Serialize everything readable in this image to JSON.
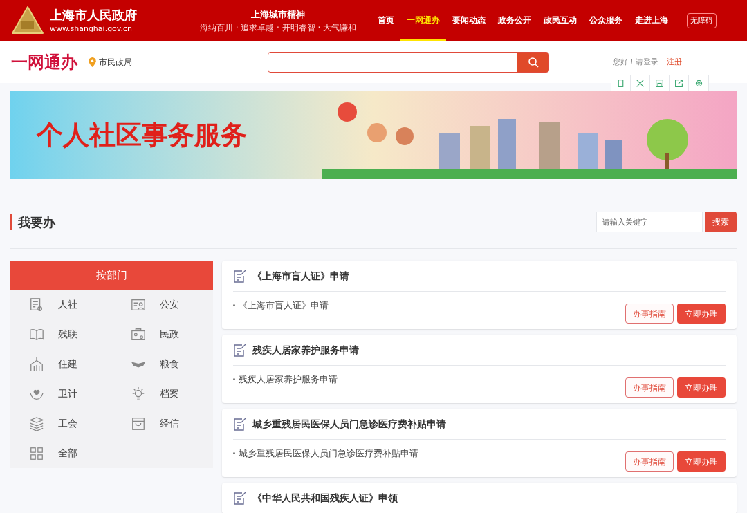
{
  "header": {
    "site_title": "上海市人民政府",
    "site_url": "www.shanghai.gov.cn",
    "motto_title": "上海城市精神",
    "motto": "海纳百川 · 追求卓越 · 开明睿智 · 大气谦和",
    "nav": [
      {
        "label": "首页",
        "selected": false
      },
      {
        "label": "一网通办",
        "selected": true
      },
      {
        "label": "要闻动态",
        "selected": false
      },
      {
        "label": "政务公开",
        "selected": false
      },
      {
        "label": "政民互动",
        "selected": false
      },
      {
        "label": "公众服务",
        "selected": false
      },
      {
        "label": "走进上海",
        "selected": false
      }
    ],
    "accessibility": "无障碍"
  },
  "subheader": {
    "brand": "一网通办",
    "location": "市民政局",
    "greeting": "您好！请登录",
    "register": "注册"
  },
  "banner": {
    "title": "个人社区事务服务"
  },
  "section": {
    "title": "我要办",
    "search_placeholder": "请输入关键字",
    "search_button": "搜索"
  },
  "departments": {
    "title": "按部门",
    "items": [
      {
        "label": "人社",
        "kind": "doc"
      },
      {
        "label": "公安",
        "kind": "id"
      },
      {
        "label": "残联",
        "kind": "book"
      },
      {
        "label": "民政",
        "kind": "case"
      },
      {
        "label": "住建",
        "kind": "house"
      },
      {
        "label": "粮食",
        "kind": "wing"
      },
      {
        "label": "卫计",
        "kind": "heart"
      },
      {
        "label": "档案",
        "kind": "bulb"
      },
      {
        "label": "工会",
        "kind": "layers"
      },
      {
        "label": "经信",
        "kind": "bag"
      },
      {
        "label": "全部",
        "kind": "grid"
      }
    ]
  },
  "services": [
    {
      "title": "《上海市盲人证》申请",
      "item": "《上海市盲人证》申请",
      "guide": "办事指南",
      "apply": "立即办理"
    },
    {
      "title": "残疾人居家养护服务申请",
      "item": "残疾人居家养护服务申请",
      "guide": "办事指南",
      "apply": "立即办理"
    },
    {
      "title": "城乡重残居民医保人员门急诊医疗费补贴申请",
      "item": "城乡重残居民医保人员门急诊医疗费补贴申请",
      "guide": "办事指南",
      "apply": "立即办理"
    },
    {
      "title": "《中华人民共和国残疾人证》申领"
    }
  ]
}
